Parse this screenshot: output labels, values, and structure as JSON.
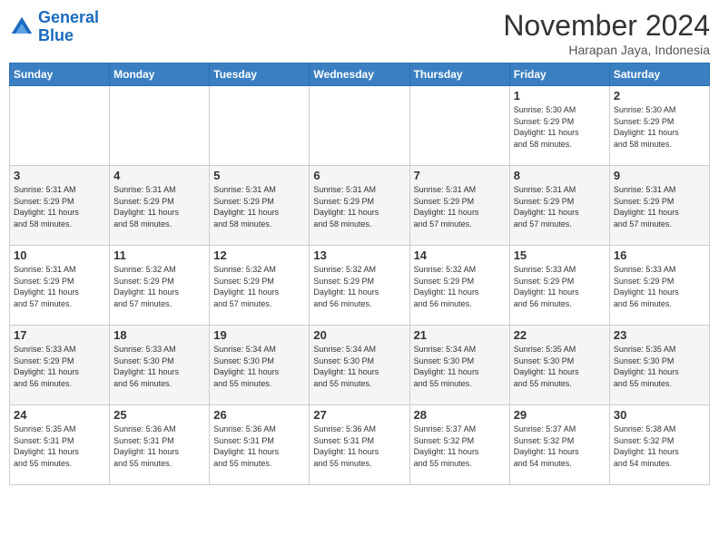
{
  "header": {
    "logo_line1": "General",
    "logo_line2": "Blue",
    "month": "November 2024",
    "location": "Harapan Jaya, Indonesia"
  },
  "weekdays": [
    "Sunday",
    "Monday",
    "Tuesday",
    "Wednesday",
    "Thursday",
    "Friday",
    "Saturday"
  ],
  "weeks": [
    [
      {
        "day": "",
        "info": ""
      },
      {
        "day": "",
        "info": ""
      },
      {
        "day": "",
        "info": ""
      },
      {
        "day": "",
        "info": ""
      },
      {
        "day": "",
        "info": ""
      },
      {
        "day": "1",
        "info": "Sunrise: 5:30 AM\nSunset: 5:29 PM\nDaylight: 11 hours\nand 58 minutes."
      },
      {
        "day": "2",
        "info": "Sunrise: 5:30 AM\nSunset: 5:29 PM\nDaylight: 11 hours\nand 58 minutes."
      }
    ],
    [
      {
        "day": "3",
        "info": "Sunrise: 5:31 AM\nSunset: 5:29 PM\nDaylight: 11 hours\nand 58 minutes."
      },
      {
        "day": "4",
        "info": "Sunrise: 5:31 AM\nSunset: 5:29 PM\nDaylight: 11 hours\nand 58 minutes."
      },
      {
        "day": "5",
        "info": "Sunrise: 5:31 AM\nSunset: 5:29 PM\nDaylight: 11 hours\nand 58 minutes."
      },
      {
        "day": "6",
        "info": "Sunrise: 5:31 AM\nSunset: 5:29 PM\nDaylight: 11 hours\nand 58 minutes."
      },
      {
        "day": "7",
        "info": "Sunrise: 5:31 AM\nSunset: 5:29 PM\nDaylight: 11 hours\nand 57 minutes."
      },
      {
        "day": "8",
        "info": "Sunrise: 5:31 AM\nSunset: 5:29 PM\nDaylight: 11 hours\nand 57 minutes."
      },
      {
        "day": "9",
        "info": "Sunrise: 5:31 AM\nSunset: 5:29 PM\nDaylight: 11 hours\nand 57 minutes."
      }
    ],
    [
      {
        "day": "10",
        "info": "Sunrise: 5:31 AM\nSunset: 5:29 PM\nDaylight: 11 hours\nand 57 minutes."
      },
      {
        "day": "11",
        "info": "Sunrise: 5:32 AM\nSunset: 5:29 PM\nDaylight: 11 hours\nand 57 minutes."
      },
      {
        "day": "12",
        "info": "Sunrise: 5:32 AM\nSunset: 5:29 PM\nDaylight: 11 hours\nand 57 minutes."
      },
      {
        "day": "13",
        "info": "Sunrise: 5:32 AM\nSunset: 5:29 PM\nDaylight: 11 hours\nand 56 minutes."
      },
      {
        "day": "14",
        "info": "Sunrise: 5:32 AM\nSunset: 5:29 PM\nDaylight: 11 hours\nand 56 minutes."
      },
      {
        "day": "15",
        "info": "Sunrise: 5:33 AM\nSunset: 5:29 PM\nDaylight: 11 hours\nand 56 minutes."
      },
      {
        "day": "16",
        "info": "Sunrise: 5:33 AM\nSunset: 5:29 PM\nDaylight: 11 hours\nand 56 minutes."
      }
    ],
    [
      {
        "day": "17",
        "info": "Sunrise: 5:33 AM\nSunset: 5:29 PM\nDaylight: 11 hours\nand 56 minutes."
      },
      {
        "day": "18",
        "info": "Sunrise: 5:33 AM\nSunset: 5:30 PM\nDaylight: 11 hours\nand 56 minutes."
      },
      {
        "day": "19",
        "info": "Sunrise: 5:34 AM\nSunset: 5:30 PM\nDaylight: 11 hours\nand 55 minutes."
      },
      {
        "day": "20",
        "info": "Sunrise: 5:34 AM\nSunset: 5:30 PM\nDaylight: 11 hours\nand 55 minutes."
      },
      {
        "day": "21",
        "info": "Sunrise: 5:34 AM\nSunset: 5:30 PM\nDaylight: 11 hours\nand 55 minutes."
      },
      {
        "day": "22",
        "info": "Sunrise: 5:35 AM\nSunset: 5:30 PM\nDaylight: 11 hours\nand 55 minutes."
      },
      {
        "day": "23",
        "info": "Sunrise: 5:35 AM\nSunset: 5:30 PM\nDaylight: 11 hours\nand 55 minutes."
      }
    ],
    [
      {
        "day": "24",
        "info": "Sunrise: 5:35 AM\nSunset: 5:31 PM\nDaylight: 11 hours\nand 55 minutes."
      },
      {
        "day": "25",
        "info": "Sunrise: 5:36 AM\nSunset: 5:31 PM\nDaylight: 11 hours\nand 55 minutes."
      },
      {
        "day": "26",
        "info": "Sunrise: 5:36 AM\nSunset: 5:31 PM\nDaylight: 11 hours\nand 55 minutes."
      },
      {
        "day": "27",
        "info": "Sunrise: 5:36 AM\nSunset: 5:31 PM\nDaylight: 11 hours\nand 55 minutes."
      },
      {
        "day": "28",
        "info": "Sunrise: 5:37 AM\nSunset: 5:32 PM\nDaylight: 11 hours\nand 55 minutes."
      },
      {
        "day": "29",
        "info": "Sunrise: 5:37 AM\nSunset: 5:32 PM\nDaylight: 11 hours\nand 54 minutes."
      },
      {
        "day": "30",
        "info": "Sunrise: 5:38 AM\nSunset: 5:32 PM\nDaylight: 11 hours\nand 54 minutes."
      }
    ]
  ]
}
